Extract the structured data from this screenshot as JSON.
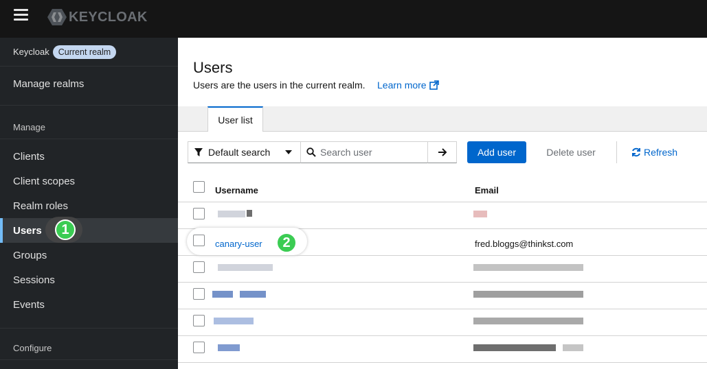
{
  "app": {
    "logo_text": "KEYCLOAK",
    "icons": {
      "menu": "hamburger-icon",
      "logo": "keycloak-logo-icon"
    }
  },
  "sidebar": {
    "realm_label": "Keycloak",
    "realm_badge": "Current realm",
    "manage_realms": "Manage realms",
    "section_manage": "Manage",
    "items": [
      {
        "label": "Clients"
      },
      {
        "label": "Client scopes"
      },
      {
        "label": "Realm roles"
      },
      {
        "label": "Users",
        "active": true
      },
      {
        "label": "Groups"
      },
      {
        "label": "Sessions"
      },
      {
        "label": "Events"
      }
    ],
    "section_configure": "Configure"
  },
  "callouts": {
    "step1": "1",
    "step2": "2"
  },
  "header": {
    "title": "Users",
    "description": "Users are the users in the current realm.",
    "learn_more": "Learn more"
  },
  "tabs": [
    {
      "label": "User list",
      "active": true
    }
  ],
  "toolbar": {
    "filter_label": "Default search",
    "search_placeholder": "Search user",
    "add_user": "Add user",
    "delete_user": "Delete user",
    "refresh": "Refresh"
  },
  "table": {
    "columns": [
      "Username",
      "Email"
    ],
    "highlighted_row": {
      "username": "canary-user",
      "email": "fred.bloggs@thinkst.com"
    }
  },
  "colors": {
    "masthead": "#151515",
    "sidebar": "#212427",
    "primary": "#0066cc",
    "callout": "#3bcc53"
  }
}
